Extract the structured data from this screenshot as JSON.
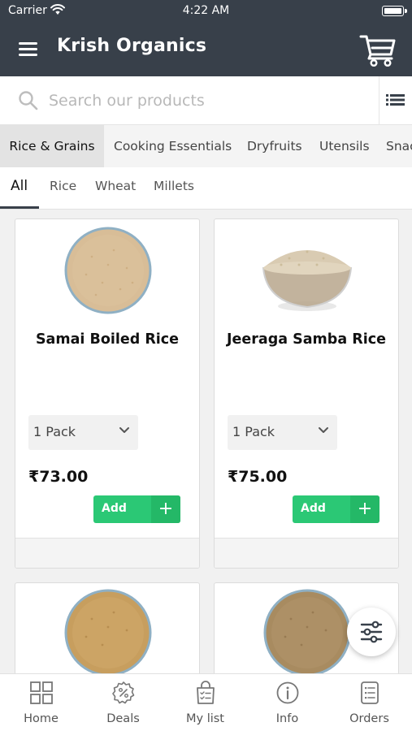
{
  "status_bar": {
    "carrier": "Carrier",
    "time": "4:22 AM"
  },
  "app": {
    "title": "Krish Organics"
  },
  "search": {
    "placeholder": "Search our products"
  },
  "categories": [
    {
      "label": "Rice & Grains",
      "active": true
    },
    {
      "label": "Cooking Essentials",
      "active": false
    },
    {
      "label": "Dryfruits",
      "active": false
    },
    {
      "label": "Utensils",
      "active": false
    },
    {
      "label": "Snacks",
      "active": false
    }
  ],
  "subcategories": [
    {
      "label": "All",
      "active": true
    },
    {
      "label": "Rice",
      "active": false
    },
    {
      "label": "Wheat",
      "active": false
    },
    {
      "label": "Millets",
      "active": false
    }
  ],
  "products": [
    {
      "name": "Samai Boiled Rice",
      "pack": "1 Pack",
      "price": "₹73.00",
      "add_label": "Add",
      "add_symbol": "+"
    },
    {
      "name": "Jeeraga Samba Rice",
      "pack": "1 Pack",
      "price": "₹75.00",
      "add_label": "Add",
      "add_symbol": "+"
    }
  ],
  "bottom_nav": [
    {
      "label": "Home",
      "icon": "grid-icon"
    },
    {
      "label": "Deals",
      "icon": "badge-percent-icon"
    },
    {
      "label": "My list",
      "icon": "shopping-bag-list-icon"
    },
    {
      "label": "Info",
      "icon": "info-icon"
    },
    {
      "label": "Orders",
      "icon": "orders-list-icon"
    }
  ],
  "colors": {
    "header": "#38404a",
    "add_button": "#2bc875",
    "add_plus": "#24b867",
    "rice_samai": "#d8bd97",
    "rice_boiled": "#c79e5e",
    "rice_brown": "#a88b60"
  }
}
